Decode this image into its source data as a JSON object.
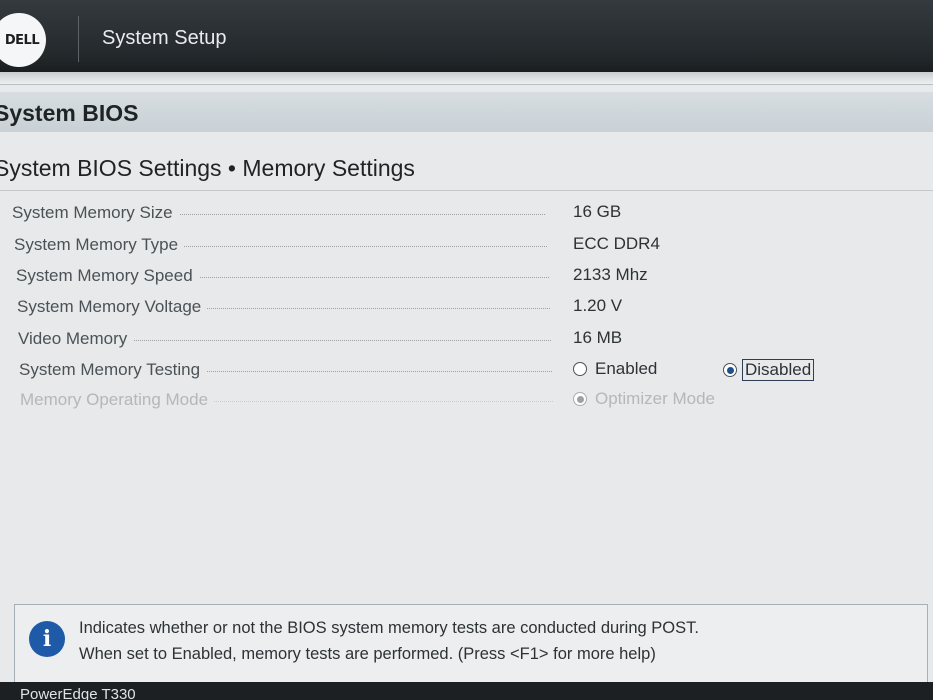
{
  "header": {
    "logo_text": "DELL",
    "app_title": "System Setup"
  },
  "page": {
    "title": "System BIOS",
    "section_title": "System BIOS Settings • Memory Settings"
  },
  "settings": [
    {
      "label": "System Memory Size",
      "value": "16 GB"
    },
    {
      "label": "System Memory Type",
      "value": "ECC DDR4"
    },
    {
      "label": "System Memory Speed",
      "value": "2133 Mhz"
    },
    {
      "label": "System Memory Voltage",
      "value": "1.20 V"
    },
    {
      "label": "Video Memory",
      "value": "16 MB"
    }
  ],
  "memory_testing": {
    "label": "System Memory Testing",
    "options": [
      "Enabled",
      "Disabled"
    ],
    "selected": "Disabled"
  },
  "memory_operating_mode": {
    "label": "Memory Operating Mode",
    "option": "Optimizer Mode",
    "enabled": false
  },
  "help": {
    "line1": "Indicates whether or not the BIOS system memory tests are conducted during POST.",
    "line2": "When set to Enabled, memory tests are performed. (Press <F1> for more help)"
  },
  "footer": {
    "model": "PowerEdge T330"
  },
  "colors": {
    "header_bg": "#23282b",
    "radio_selected": "#1d4f8c",
    "info_icon": "#1e5aa8"
  }
}
